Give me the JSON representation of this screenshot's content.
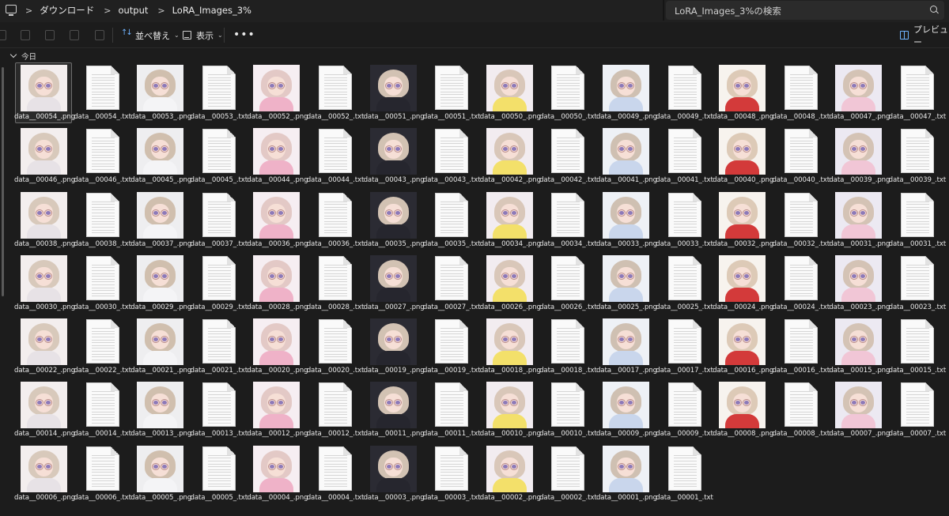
{
  "address_bar": {
    "breadcrumbs": [
      "ダウンロード",
      "output",
      "LoRA_Images_3%"
    ],
    "search_placeholder": "LoRA_Images_3%の検索"
  },
  "toolbar": {
    "sort_label": "並べ替え",
    "view_label": "表示",
    "more_label": "•••",
    "preview_label": "プレビュー"
  },
  "group": {
    "label": "今日"
  },
  "colors": {
    "background": "#1c1c1c",
    "accent": "#6fb3ff",
    "text": "#e6e6e6"
  },
  "files": [
    {
      "name": "data__00054_.png",
      "type": "png",
      "selected": true
    },
    {
      "name": "data__00054_.txt",
      "type": "txt"
    },
    {
      "name": "data__00053_.png",
      "type": "png"
    },
    {
      "name": "data__00053_.txt",
      "type": "txt"
    },
    {
      "name": "data__00052_.png",
      "type": "png"
    },
    {
      "name": "data__00052_.txt",
      "type": "txt"
    },
    {
      "name": "data__00051_.png",
      "type": "png"
    },
    {
      "name": "data__00051_.txt",
      "type": "txt"
    },
    {
      "name": "data__00050_.png",
      "type": "png"
    },
    {
      "name": "data__00050_.txt",
      "type": "txt"
    },
    {
      "name": "data__00049_.png",
      "type": "png"
    },
    {
      "name": "data__00049_.txt",
      "type": "txt"
    },
    {
      "name": "data__00048_.png",
      "type": "png"
    },
    {
      "name": "data__00048_.txt",
      "type": "txt"
    },
    {
      "name": "data__00047_.png",
      "type": "png"
    },
    {
      "name": "data__00047_.txt",
      "type": "txt"
    },
    {
      "name": "data__00046_.png",
      "type": "png"
    },
    {
      "name": "data__00046_.txt",
      "type": "txt"
    },
    {
      "name": "data__00045_.png",
      "type": "png"
    },
    {
      "name": "data__00045_.txt",
      "type": "txt"
    },
    {
      "name": "data__00044_.png",
      "type": "png"
    },
    {
      "name": "data__00044_.txt",
      "type": "txt"
    },
    {
      "name": "data__00043_.png",
      "type": "png"
    },
    {
      "name": "data__00043_.txt",
      "type": "txt"
    },
    {
      "name": "data__00042_.png",
      "type": "png"
    },
    {
      "name": "data__00042_.txt",
      "type": "txt"
    },
    {
      "name": "data__00041_.png",
      "type": "png"
    },
    {
      "name": "data__00041_.txt",
      "type": "txt"
    },
    {
      "name": "data__00040_.png",
      "type": "png"
    },
    {
      "name": "data__00040_.txt",
      "type": "txt"
    },
    {
      "name": "data__00039_.png",
      "type": "png"
    },
    {
      "name": "data__00039_.txt",
      "type": "txt"
    },
    {
      "name": "data__00038_.png",
      "type": "png"
    },
    {
      "name": "data__00038_.txt",
      "type": "txt"
    },
    {
      "name": "data__00037_.png",
      "type": "png"
    },
    {
      "name": "data__00037_.txt",
      "type": "txt"
    },
    {
      "name": "data__00036_.png",
      "type": "png"
    },
    {
      "name": "data__00036_.txt",
      "type": "txt"
    },
    {
      "name": "data__00035_.png",
      "type": "png"
    },
    {
      "name": "data__00035_.txt",
      "type": "txt"
    },
    {
      "name": "data__00034_.png",
      "type": "png"
    },
    {
      "name": "data__00034_.txt",
      "type": "txt"
    },
    {
      "name": "data__00033_.png",
      "type": "png"
    },
    {
      "name": "data__00033_.txt",
      "type": "txt"
    },
    {
      "name": "data__00032_.png",
      "type": "png"
    },
    {
      "name": "data__00032_.txt",
      "type": "txt"
    },
    {
      "name": "data__00031_.png",
      "type": "png"
    },
    {
      "name": "data__00031_.txt",
      "type": "txt"
    },
    {
      "name": "data__00030_.png",
      "type": "png"
    },
    {
      "name": "data__00030_.txt",
      "type": "txt"
    },
    {
      "name": "data__00029_.png",
      "type": "png"
    },
    {
      "name": "data__00029_.txt",
      "type": "txt"
    },
    {
      "name": "data__00028_.png",
      "type": "png"
    },
    {
      "name": "data__00028_.txt",
      "type": "txt"
    },
    {
      "name": "data__00027_.png",
      "type": "png"
    },
    {
      "name": "data__00027_.txt",
      "type": "txt"
    },
    {
      "name": "data__00026_.png",
      "type": "png"
    },
    {
      "name": "data__00026_.txt",
      "type": "txt"
    },
    {
      "name": "data__00025_.png",
      "type": "png"
    },
    {
      "name": "data__00025_.txt",
      "type": "txt"
    },
    {
      "name": "data__00024_.png",
      "type": "png"
    },
    {
      "name": "data__00024_.txt",
      "type": "txt"
    },
    {
      "name": "data__00023_.png",
      "type": "png"
    },
    {
      "name": "data__00023_.txt",
      "type": "txt"
    },
    {
      "name": "data__00022_.png",
      "type": "png"
    },
    {
      "name": "data__00022_.txt",
      "type": "txt"
    },
    {
      "name": "data__00021_.png",
      "type": "png"
    },
    {
      "name": "data__00021_.txt",
      "type": "txt"
    },
    {
      "name": "data__00020_.png",
      "type": "png"
    },
    {
      "name": "data__00020_.txt",
      "type": "txt"
    },
    {
      "name": "data__00019_.png",
      "type": "png"
    },
    {
      "name": "data__00019_.txt",
      "type": "txt"
    },
    {
      "name": "data__00018_.png",
      "type": "png"
    },
    {
      "name": "data__00018_.txt",
      "type": "txt"
    },
    {
      "name": "data__00017_.png",
      "type": "png"
    },
    {
      "name": "data__00017_.txt",
      "type": "txt"
    },
    {
      "name": "data__00016_.png",
      "type": "png"
    },
    {
      "name": "data__00016_.txt",
      "type": "txt"
    },
    {
      "name": "data__00015_.png",
      "type": "png"
    },
    {
      "name": "data__00015_.txt",
      "type": "txt"
    },
    {
      "name": "data__00014_.png",
      "type": "png"
    },
    {
      "name": "data__00014_.txt",
      "type": "txt"
    },
    {
      "name": "data__00013_.png",
      "type": "png"
    },
    {
      "name": "data__00013_.txt",
      "type": "txt"
    },
    {
      "name": "data__00012_.png",
      "type": "png"
    },
    {
      "name": "data__00012_.txt",
      "type": "txt"
    },
    {
      "name": "data__00011_.png",
      "type": "png"
    },
    {
      "name": "data__00011_.txt",
      "type": "txt"
    },
    {
      "name": "data__00010_.png",
      "type": "png"
    },
    {
      "name": "data__00010_.txt",
      "type": "txt"
    },
    {
      "name": "data__00009_.png",
      "type": "png"
    },
    {
      "name": "data__00009_.txt",
      "type": "txt"
    },
    {
      "name": "data__00008_.png",
      "type": "png"
    },
    {
      "name": "data__00008_.txt",
      "type": "txt"
    },
    {
      "name": "data__00007_.png",
      "type": "png"
    },
    {
      "name": "data__00007_.txt",
      "type": "txt"
    },
    {
      "name": "data__00006_.png",
      "type": "png"
    },
    {
      "name": "data__00006_.txt",
      "type": "txt"
    },
    {
      "name": "data__00005_.png",
      "type": "png"
    },
    {
      "name": "data__00005_.txt",
      "type": "txt"
    },
    {
      "name": "data__00004_.png",
      "type": "png"
    },
    {
      "name": "data__00004_.txt",
      "type": "txt"
    },
    {
      "name": "data__00003_.png",
      "type": "png"
    },
    {
      "name": "data__00003_.txt",
      "type": "txt"
    },
    {
      "name": "data__00002_.png",
      "type": "png"
    },
    {
      "name": "data__00002_.txt",
      "type": "txt"
    },
    {
      "name": "data__00001_.png",
      "type": "png"
    },
    {
      "name": "data__00001_.txt",
      "type": "txt"
    }
  ]
}
